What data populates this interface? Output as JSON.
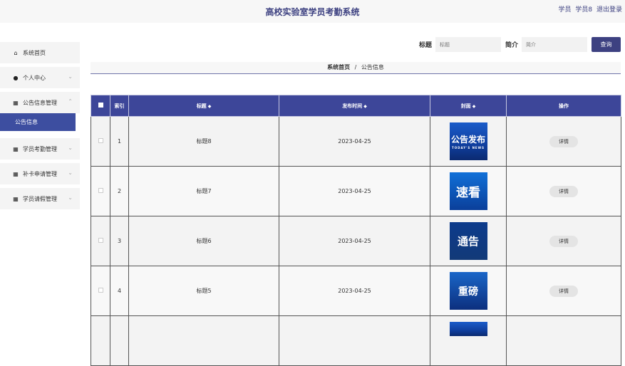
{
  "header": {
    "title": "高校实验室学员考勤系统",
    "role": "学员",
    "username": "学员8",
    "logout": "退出登录"
  },
  "sidebar": {
    "items": [
      {
        "label": "系统首页",
        "icon": "home-icon"
      },
      {
        "label": "个人中心",
        "icon": "user-icon"
      },
      {
        "label": "公告信息管理",
        "icon": "grid-icon"
      },
      {
        "label": "学员考勤管理",
        "icon": "grid-icon"
      },
      {
        "label": "补卡申请管理",
        "icon": "grid-icon"
      },
      {
        "label": "学员请假管理",
        "icon": "grid-icon"
      }
    ],
    "active_sub": "公告信息"
  },
  "search": {
    "title_label": "标题",
    "title_placeholder": "标题",
    "intro_label": "简介",
    "intro_placeholder": "简介",
    "button": "查询"
  },
  "breadcrumb": {
    "home": "系统首页",
    "sep": "/",
    "current": "公告信息"
  },
  "table": {
    "headers": {
      "index": "索引",
      "title": "标题",
      "time": "发布时间",
      "cover": "封面",
      "action": "操作"
    },
    "rows": [
      {
        "index": "1",
        "title": "标题8",
        "time": "2023-04-25",
        "cover_text": "公告发布",
        "cover_sub": "TODAY'S NEWS",
        "action": "详情"
      },
      {
        "index": "2",
        "title": "标题7",
        "time": "2023-04-25",
        "cover_text": "速看",
        "action": "详情"
      },
      {
        "index": "3",
        "title": "标题6",
        "time": "2023-04-25",
        "cover_text": "通告",
        "action": "详情"
      },
      {
        "index": "4",
        "title": "标题5",
        "time": "2023-04-25",
        "cover_text": "重磅",
        "action": "详情"
      }
    ]
  }
}
